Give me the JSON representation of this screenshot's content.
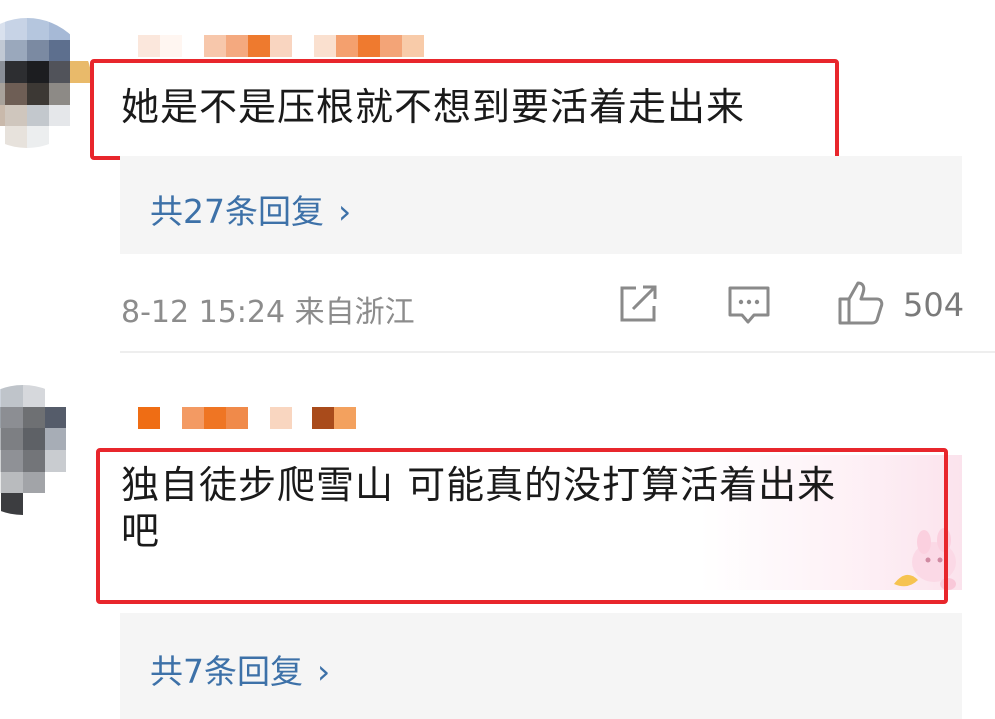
{
  "comments": [
    {
      "text": "她是不是压根就不想到要活着走出来",
      "reply_label": "共27条回复",
      "meta": "8-12 15:24 来自浙江",
      "likes": "504"
    },
    {
      "text": "独自徒步爬雪山 可能真的没打算活着出来\n吧",
      "reply_label": "共7条回复"
    }
  ],
  "icons": {
    "share": "share-icon",
    "comment": "comment-icon",
    "like": "thumbs-up-icon",
    "chevron": "›"
  },
  "colors": {
    "highlight": "#e8262c",
    "link": "#3d71a8",
    "meta": "#8c8c8c"
  }
}
